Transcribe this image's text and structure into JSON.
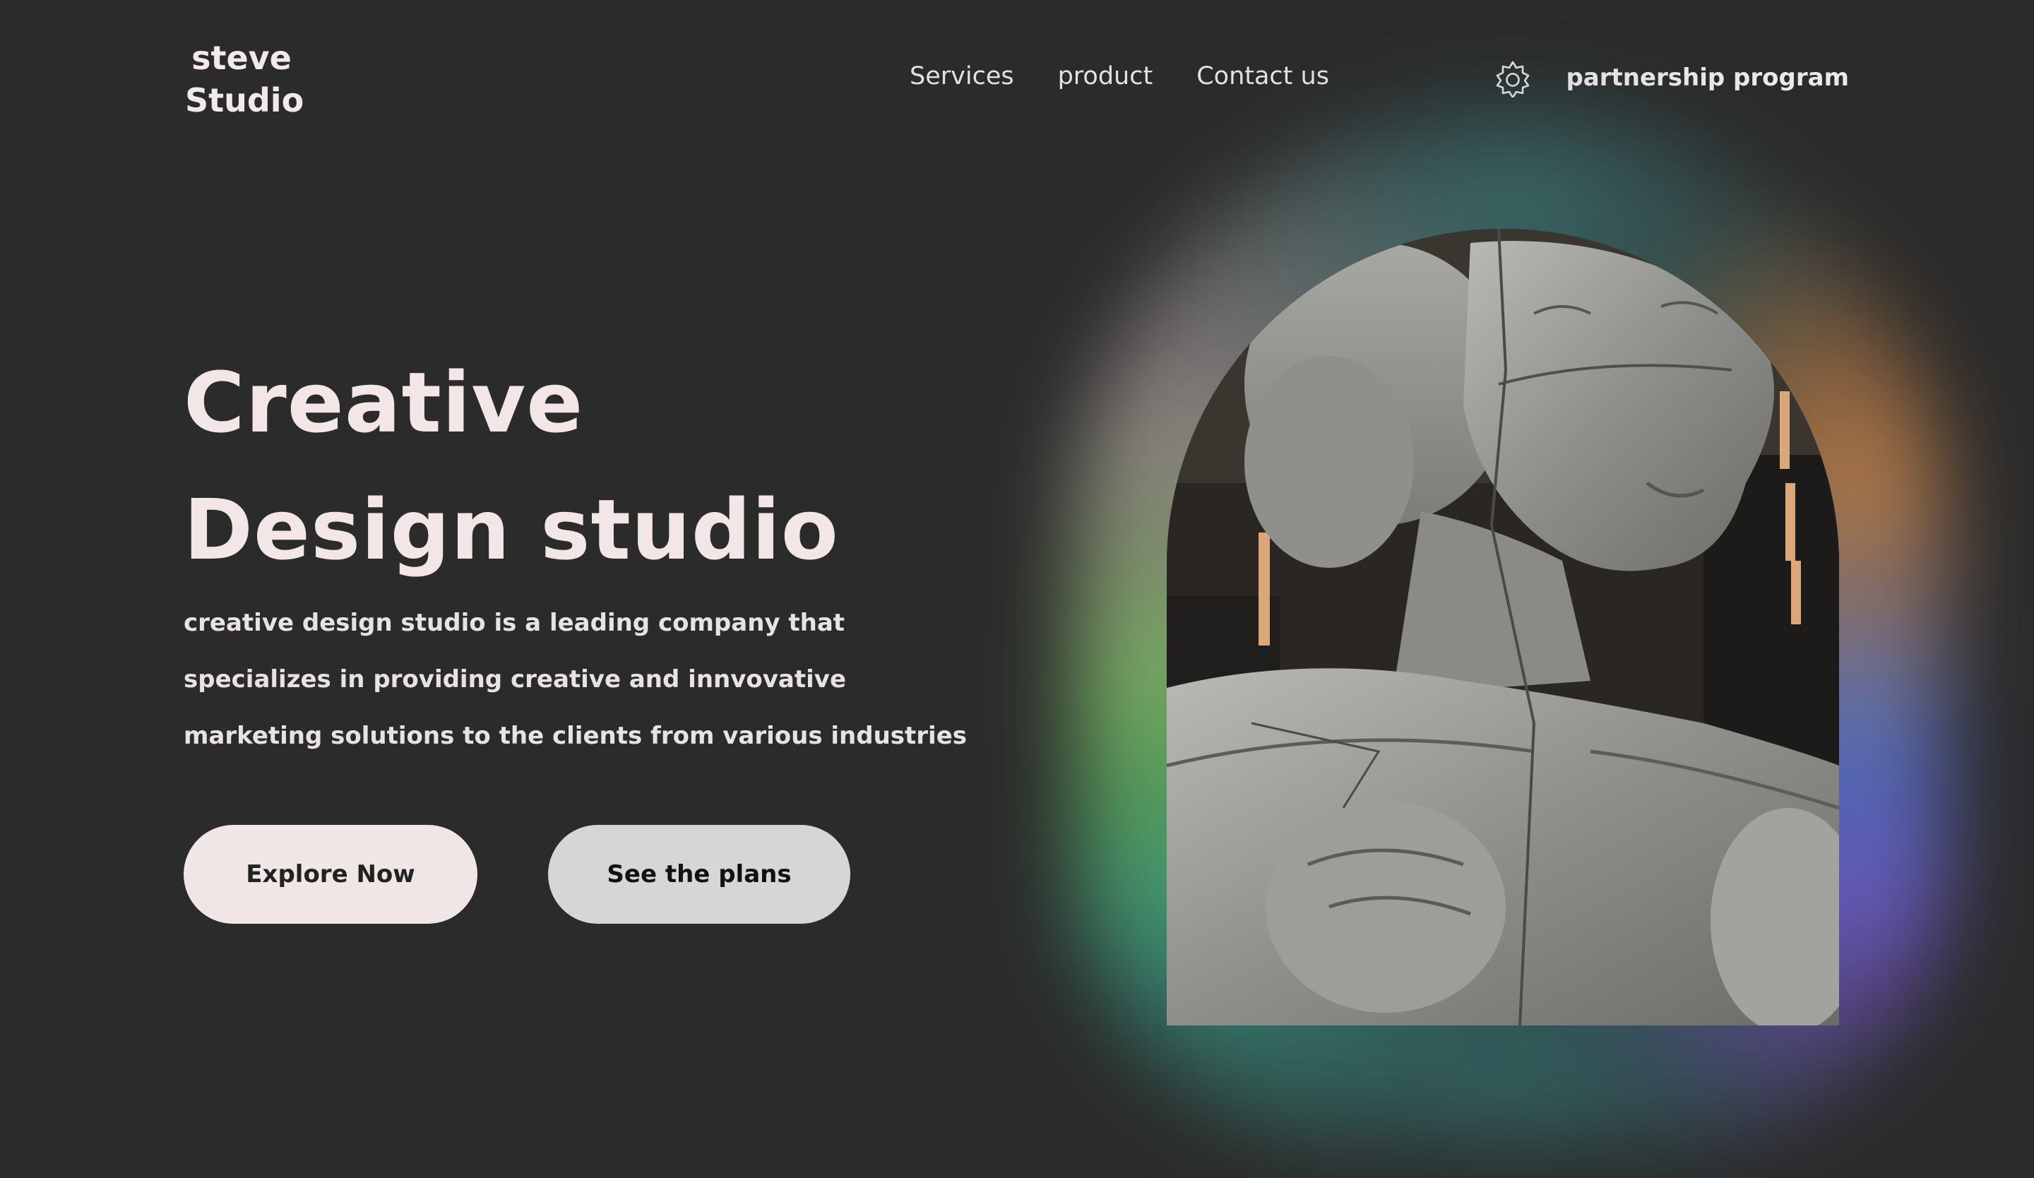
{
  "brand": {
    "line1": "steve",
    "line2": "Studio"
  },
  "nav": {
    "items": [
      "Services",
      "product",
      "Contact us"
    ]
  },
  "header": {
    "theme_icon": "sun-icon",
    "partnership_label": "partnership program"
  },
  "hero": {
    "title_line1": "Creative",
    "title_line2": "Design studio",
    "description": "creative design studio  is a leading company that specializes in providing creative and innvovative marketing solutions to the clients from various industries",
    "primary_button": "Explore Now",
    "secondary_button": "See the plans",
    "image_subject": "stone statue of a woman's head and torso"
  },
  "colors": {
    "background": "#2b2b2b",
    "text_light": "#f3e6e6",
    "button_primary": "#f1e6e6",
    "button_secondary": "#d6d6d6"
  }
}
